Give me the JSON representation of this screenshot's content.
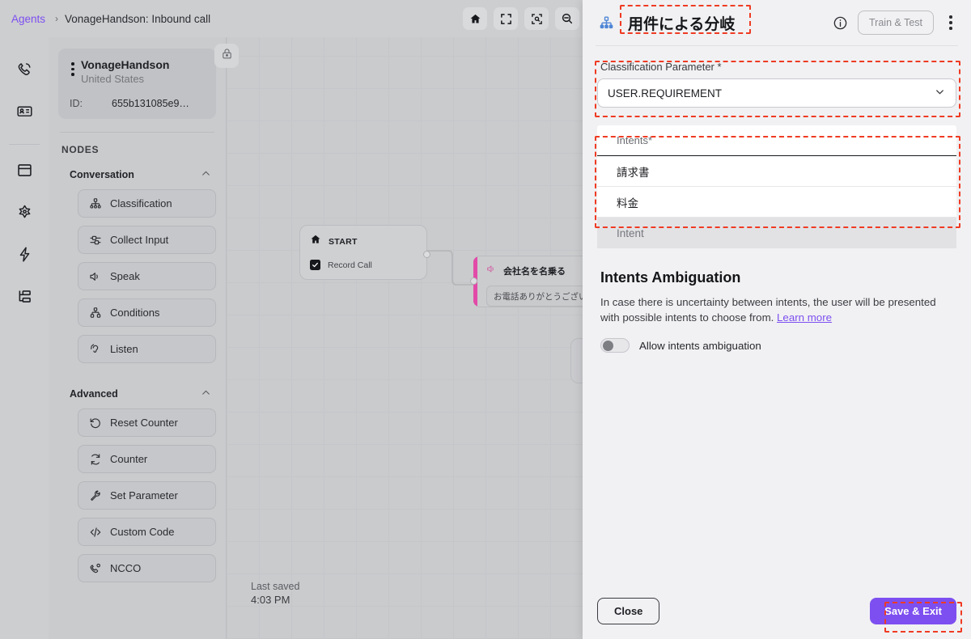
{
  "topbar": {
    "breadcrumb_root": "Agents",
    "breadcrumb_separator": "›",
    "breadcrumb_current": "VonageHandson: Inbound call",
    "actions": [
      {
        "name": "home-icon",
        "label": "Home"
      },
      {
        "name": "fit-screen-icon",
        "label": "Fit to screen"
      },
      {
        "name": "zoom-to-selection-icon",
        "label": "Zoom to selection"
      },
      {
        "name": "zoom-out-icon",
        "label": "Zoom out"
      }
    ]
  },
  "rail": {
    "items": [
      {
        "name": "calls-icon",
        "label": "Calls"
      },
      {
        "name": "contact-card-icon",
        "label": "Contacts"
      },
      {
        "name": "window-icon",
        "label": "Workspace"
      },
      {
        "name": "navigator-icon",
        "label": "Navigator"
      },
      {
        "name": "bolt-icon",
        "label": "Automations"
      },
      {
        "name": "hierarchy-icon",
        "label": "Flows"
      }
    ]
  },
  "sidebar": {
    "agent": {
      "name": "VonageHandson",
      "country": "United States",
      "id_label": "ID:",
      "id_value": "655b131085e9…"
    },
    "lock_icon": "lock-icon",
    "nodes_header": "NODES",
    "groups": [
      {
        "title": "Conversation",
        "collapse_icon": "chevron-up-icon",
        "items": [
          {
            "label": "Classification",
            "icon": "classification-icon"
          },
          {
            "label": "Collect Input",
            "icon": "collect-input-icon"
          },
          {
            "label": "Speak",
            "icon": "speaker-icon"
          },
          {
            "label": "Conditions",
            "icon": "conditions-icon"
          },
          {
            "label": "Listen",
            "icon": "listen-icon"
          }
        ]
      },
      {
        "title": "Advanced",
        "collapse_icon": "chevron-up-icon",
        "items": [
          {
            "label": "Reset Counter",
            "icon": "reset-counter-icon"
          },
          {
            "label": "Counter",
            "icon": "counter-icon"
          },
          {
            "label": "Set Parameter",
            "icon": "wrench-icon"
          },
          {
            "label": "Custom Code",
            "icon": "code-icon"
          },
          {
            "label": "NCCO",
            "icon": "ncco-icon"
          }
        ]
      }
    ]
  },
  "canvas": {
    "start_node": {
      "title": "START",
      "icon": "home-icon",
      "option_label": "Record Call",
      "option_checked": true
    },
    "speak_node": {
      "title": "会社名を名乗る",
      "icon": "speaker-icon",
      "text": "お電話ありがとうございます。K…",
      "accent_color": "#e24aa8"
    },
    "last_saved_label": "Last saved",
    "last_saved_time": "4:03 PM"
  },
  "panel": {
    "icon": "classification-icon",
    "title": "用件による分岐",
    "info_icon": "info-icon",
    "train_test_label": "Train & Test",
    "more_icon": "more-vertical-icon",
    "classification_parameter": {
      "label": "Classification Parameter *",
      "value": "USER.REQUIREMENT",
      "chevron_icon": "chevron-down-icon"
    },
    "intents": {
      "header": "Intents*",
      "rows": [
        {
          "label": "請求書",
          "disabled": false
        },
        {
          "label": "料金",
          "disabled": false
        },
        {
          "label": "Intent",
          "disabled": true
        }
      ]
    },
    "ambiguation": {
      "title": "Intents Ambiguation",
      "description": "In case there is uncertainty between intents, the user will be presented with possible intents to choose from. ",
      "link_label": "Learn more",
      "toggle_label": "Allow intents ambiguation",
      "toggle_on": false
    },
    "footer": {
      "close_label": "Close",
      "save_label": "Save & Exit"
    }
  },
  "colors": {
    "accent_purple": "#7d4ff0",
    "annotation_red": "#ef3b23",
    "speak_node_pink": "#e24aa8",
    "classification_blue": "#4f86d6"
  }
}
